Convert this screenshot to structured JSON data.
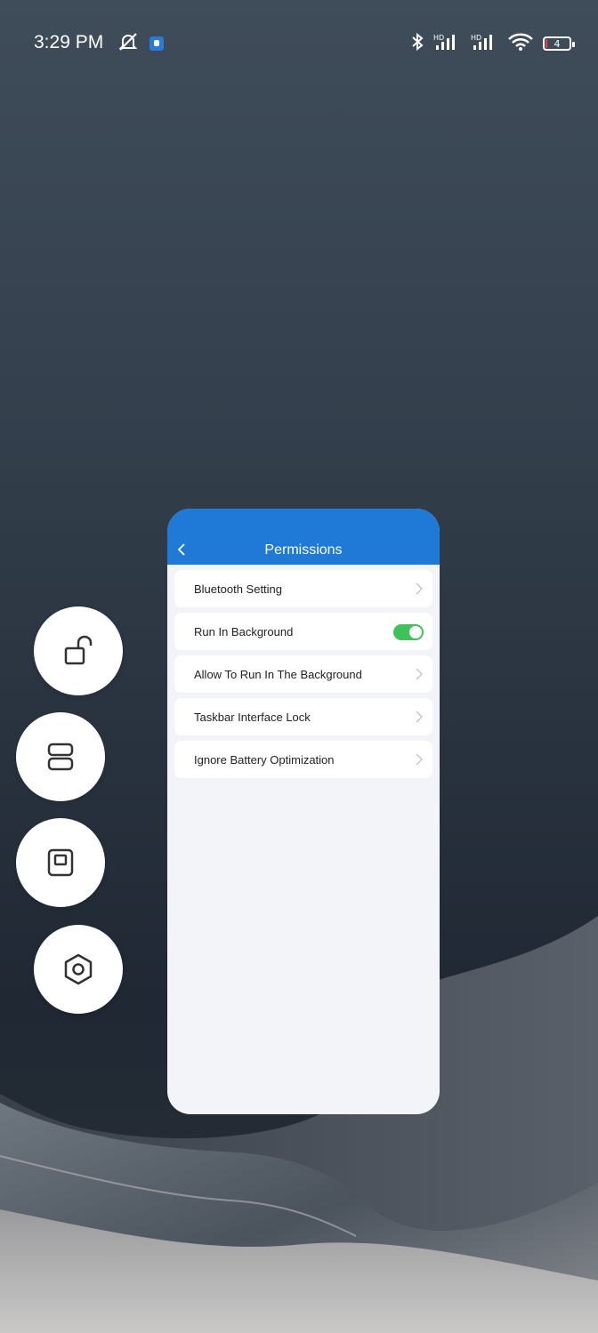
{
  "status_bar": {
    "time": "3:29 PM",
    "battery_level": "4",
    "battery_color": "#ff3b30",
    "icons_left": [
      "mute-icon",
      "app-notification-icon"
    ],
    "icons_right": [
      "bluetooth-icon",
      "hd-signal-icon",
      "hd-signal-icon",
      "wifi-icon",
      "battery-icon"
    ]
  },
  "floating_menu": {
    "items": [
      {
        "name": "unlock-icon"
      },
      {
        "name": "split-layout-icon"
      },
      {
        "name": "window-icon"
      },
      {
        "name": "settings-hex-icon"
      }
    ]
  },
  "panel": {
    "title": "Permissions",
    "header_color": "#1e7ad6",
    "back_icon": "chevron-left-icon",
    "items": [
      {
        "label": "Bluetooth Setting",
        "control": "chevron"
      },
      {
        "label": "Run In Background",
        "control": "toggle",
        "on": true,
        "toggle_color": "#3ec35b"
      },
      {
        "label": "Allow To Run In The Background",
        "control": "chevron"
      },
      {
        "label": "Taskbar Interface Lock",
        "control": "chevron"
      },
      {
        "label": "Ignore Battery Optimization",
        "control": "chevron"
      }
    ]
  }
}
